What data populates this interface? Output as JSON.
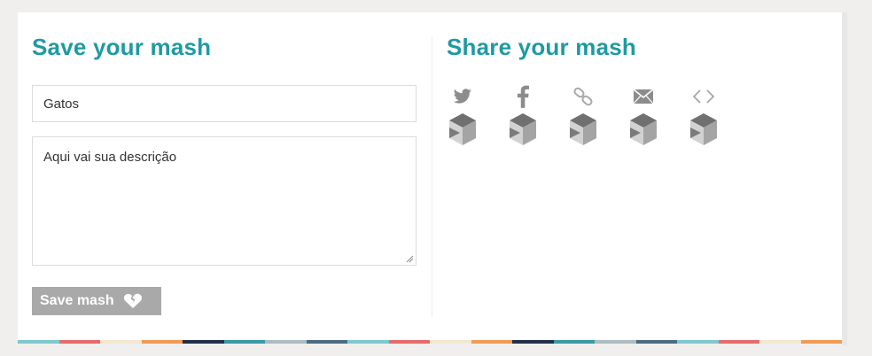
{
  "save_section": {
    "heading": "Save your mash",
    "title_value": "Gatos",
    "description_value": "Aqui vai sua descrição",
    "save_button_label": "Save mash"
  },
  "share_section": {
    "heading": "Share your mash",
    "options": [
      {
        "name": "twitter",
        "icon": "twitter-icon"
      },
      {
        "name": "facebook",
        "icon": "facebook-icon"
      },
      {
        "name": "link",
        "icon": "link-icon"
      },
      {
        "name": "email",
        "icon": "email-icon"
      },
      {
        "name": "embed",
        "icon": "embed-icon"
      }
    ]
  },
  "colors": {
    "heading": "#1e9aa3",
    "button_bg": "#a9a9a9",
    "stripe": [
      "#7fc9cd",
      "#e86b6b",
      "#f3e7d0",
      "#f09a56",
      "#1f3048",
      "#3a9aa2",
      "#aebcc0",
      "#4c6c80",
      "#7fc9cd",
      "#e86b6b",
      "#f3e7d0",
      "#f09a56",
      "#1f3048",
      "#3a9aa2",
      "#aebcc0",
      "#4c6c80",
      "#7fc9cd",
      "#e86b6b",
      "#f3e7d0",
      "#f09a56"
    ]
  }
}
